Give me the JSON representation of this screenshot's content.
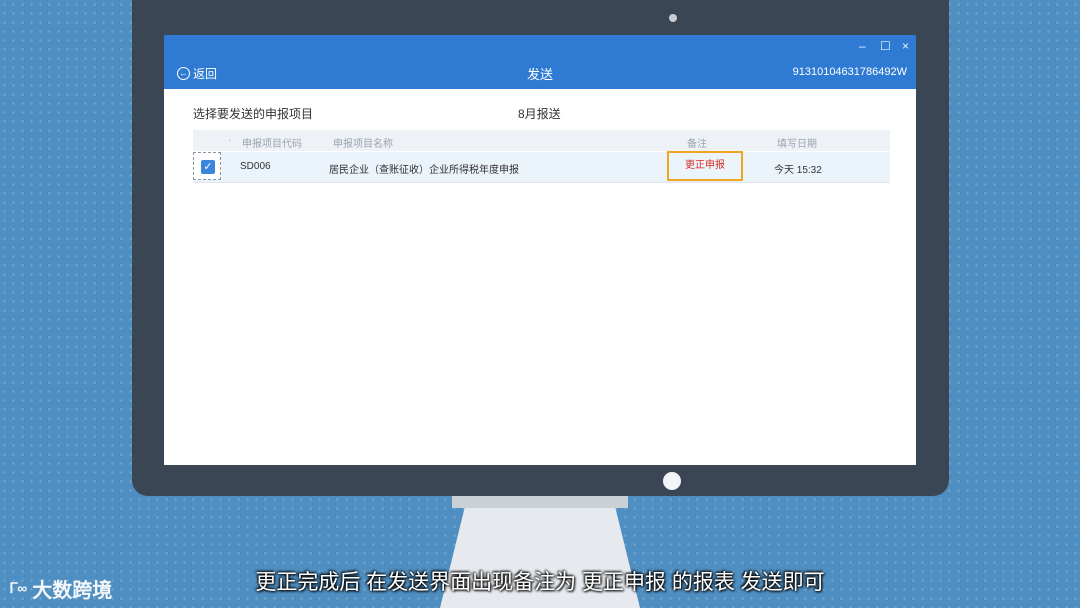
{
  "window": {
    "title": "发送",
    "back_label": "返回",
    "tax_id": "91310104631786492W",
    "controls": {
      "minimize": "–",
      "maximize": "☐",
      "close": "×"
    }
  },
  "content": {
    "prompt": "选择要发送的申报项目",
    "period": "8月报送"
  },
  "table": {
    "marker": "·",
    "headers": {
      "code": "申报项目代码",
      "name": "申报项目名称",
      "remark": "备注",
      "date": "填写日期"
    },
    "rows": [
      {
        "checked": true,
        "check_glyph": "✓",
        "code": "SD006",
        "name": "居民企业（查账征收）企业所得税年度申报",
        "remark": "更正申报",
        "date": "今天 15:32"
      }
    ]
  },
  "overlay": {
    "subtitle": "更正完成后 在发送界面出现备注为 更正申报 的报表 发送即可",
    "brand": "大数跨境",
    "brand_mark": "Ꮁ∞"
  },
  "colors": {
    "titlebar": "#2f7bd3",
    "highlight_border": "#f0a71f",
    "remark_text": "#d93025",
    "checkbox": "#3a86dc"
  }
}
